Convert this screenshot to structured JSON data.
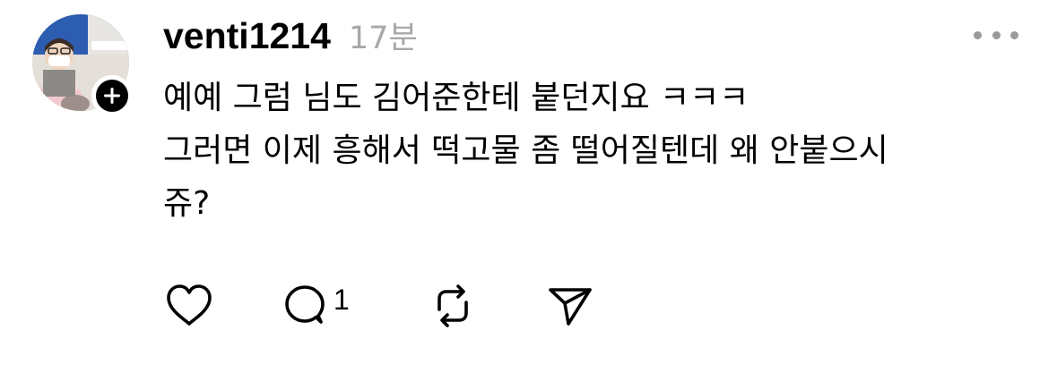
{
  "post": {
    "username": "venti1214",
    "timestamp": "17분",
    "body_lines": [
      "예예 그럼 님도 김어준한테 붙던지요 ㅋㅋㅋ",
      "그러면 이제 흥해서 떡고물 좀 떨어질텐데 왜 안붙으시",
      "쥬?"
    ]
  },
  "actions": {
    "like_icon": "heart-icon",
    "reply_icon": "comment-icon",
    "reply_count": "1",
    "repost_icon": "repost-icon",
    "share_icon": "send-icon"
  },
  "menu": {
    "icon": "more-horizontal-icon"
  },
  "avatar": {
    "badge_icon": "plus-icon"
  }
}
